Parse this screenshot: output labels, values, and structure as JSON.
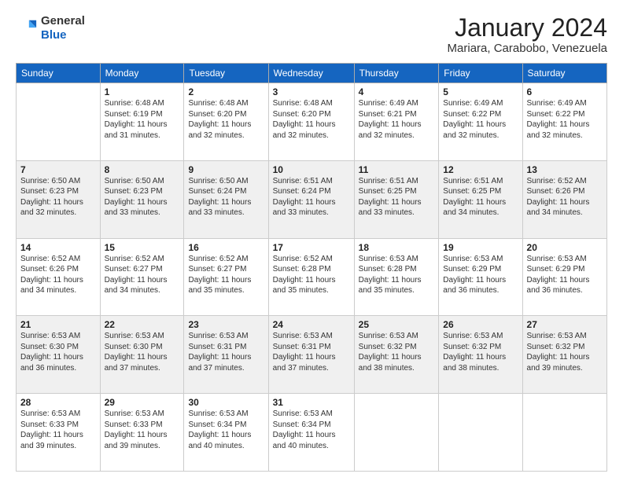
{
  "header": {
    "logo_line1": "General",
    "logo_line2": "Blue",
    "month": "January 2024",
    "location": "Mariara, Carabobo, Venezuela"
  },
  "days_of_week": [
    "Sunday",
    "Monday",
    "Tuesday",
    "Wednesday",
    "Thursday",
    "Friday",
    "Saturday"
  ],
  "weeks": [
    [
      {
        "day": "",
        "info": ""
      },
      {
        "day": "1",
        "info": "Sunrise: 6:48 AM\nSunset: 6:19 PM\nDaylight: 11 hours\nand 31 minutes."
      },
      {
        "day": "2",
        "info": "Sunrise: 6:48 AM\nSunset: 6:20 PM\nDaylight: 11 hours\nand 32 minutes."
      },
      {
        "day": "3",
        "info": "Sunrise: 6:48 AM\nSunset: 6:20 PM\nDaylight: 11 hours\nand 32 minutes."
      },
      {
        "day": "4",
        "info": "Sunrise: 6:49 AM\nSunset: 6:21 PM\nDaylight: 11 hours\nand 32 minutes."
      },
      {
        "day": "5",
        "info": "Sunrise: 6:49 AM\nSunset: 6:22 PM\nDaylight: 11 hours\nand 32 minutes."
      },
      {
        "day": "6",
        "info": "Sunrise: 6:49 AM\nSunset: 6:22 PM\nDaylight: 11 hours\nand 32 minutes."
      }
    ],
    [
      {
        "day": "7",
        "info": "Sunrise: 6:50 AM\nSunset: 6:23 PM\nDaylight: 11 hours\nand 32 minutes."
      },
      {
        "day": "8",
        "info": "Sunrise: 6:50 AM\nSunset: 6:23 PM\nDaylight: 11 hours\nand 33 minutes."
      },
      {
        "day": "9",
        "info": "Sunrise: 6:50 AM\nSunset: 6:24 PM\nDaylight: 11 hours\nand 33 minutes."
      },
      {
        "day": "10",
        "info": "Sunrise: 6:51 AM\nSunset: 6:24 PM\nDaylight: 11 hours\nand 33 minutes."
      },
      {
        "day": "11",
        "info": "Sunrise: 6:51 AM\nSunset: 6:25 PM\nDaylight: 11 hours\nand 33 minutes."
      },
      {
        "day": "12",
        "info": "Sunrise: 6:51 AM\nSunset: 6:25 PM\nDaylight: 11 hours\nand 34 minutes."
      },
      {
        "day": "13",
        "info": "Sunrise: 6:52 AM\nSunset: 6:26 PM\nDaylight: 11 hours\nand 34 minutes."
      }
    ],
    [
      {
        "day": "14",
        "info": "Sunrise: 6:52 AM\nSunset: 6:26 PM\nDaylight: 11 hours\nand 34 minutes."
      },
      {
        "day": "15",
        "info": "Sunrise: 6:52 AM\nSunset: 6:27 PM\nDaylight: 11 hours\nand 34 minutes."
      },
      {
        "day": "16",
        "info": "Sunrise: 6:52 AM\nSunset: 6:27 PM\nDaylight: 11 hours\nand 35 minutes."
      },
      {
        "day": "17",
        "info": "Sunrise: 6:52 AM\nSunset: 6:28 PM\nDaylight: 11 hours\nand 35 minutes."
      },
      {
        "day": "18",
        "info": "Sunrise: 6:53 AM\nSunset: 6:28 PM\nDaylight: 11 hours\nand 35 minutes."
      },
      {
        "day": "19",
        "info": "Sunrise: 6:53 AM\nSunset: 6:29 PM\nDaylight: 11 hours\nand 36 minutes."
      },
      {
        "day": "20",
        "info": "Sunrise: 6:53 AM\nSunset: 6:29 PM\nDaylight: 11 hours\nand 36 minutes."
      }
    ],
    [
      {
        "day": "21",
        "info": "Sunrise: 6:53 AM\nSunset: 6:30 PM\nDaylight: 11 hours\nand 36 minutes."
      },
      {
        "day": "22",
        "info": "Sunrise: 6:53 AM\nSunset: 6:30 PM\nDaylight: 11 hours\nand 37 minutes."
      },
      {
        "day": "23",
        "info": "Sunrise: 6:53 AM\nSunset: 6:31 PM\nDaylight: 11 hours\nand 37 minutes."
      },
      {
        "day": "24",
        "info": "Sunrise: 6:53 AM\nSunset: 6:31 PM\nDaylight: 11 hours\nand 37 minutes."
      },
      {
        "day": "25",
        "info": "Sunrise: 6:53 AM\nSunset: 6:32 PM\nDaylight: 11 hours\nand 38 minutes."
      },
      {
        "day": "26",
        "info": "Sunrise: 6:53 AM\nSunset: 6:32 PM\nDaylight: 11 hours\nand 38 minutes."
      },
      {
        "day": "27",
        "info": "Sunrise: 6:53 AM\nSunset: 6:32 PM\nDaylight: 11 hours\nand 39 minutes."
      }
    ],
    [
      {
        "day": "28",
        "info": "Sunrise: 6:53 AM\nSunset: 6:33 PM\nDaylight: 11 hours\nand 39 minutes."
      },
      {
        "day": "29",
        "info": "Sunrise: 6:53 AM\nSunset: 6:33 PM\nDaylight: 11 hours\nand 39 minutes."
      },
      {
        "day": "30",
        "info": "Sunrise: 6:53 AM\nSunset: 6:34 PM\nDaylight: 11 hours\nand 40 minutes."
      },
      {
        "day": "31",
        "info": "Sunrise: 6:53 AM\nSunset: 6:34 PM\nDaylight: 11 hours\nand 40 minutes."
      },
      {
        "day": "",
        "info": ""
      },
      {
        "day": "",
        "info": ""
      },
      {
        "day": "",
        "info": ""
      }
    ]
  ]
}
